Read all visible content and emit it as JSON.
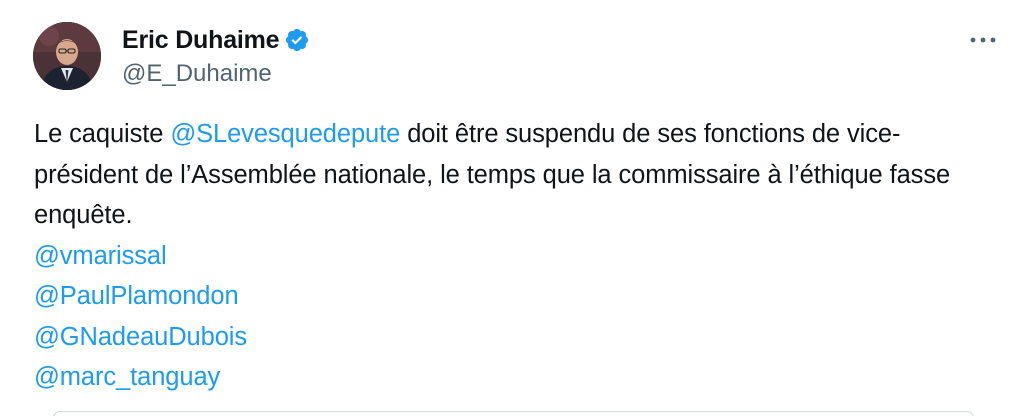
{
  "user": {
    "display_name": "Eric Duhaime",
    "handle": "@E_Duhaime",
    "verified_icon": "verified-badge-icon"
  },
  "tweet": {
    "text_before_mention": "Le caquiste ",
    "inline_mention": "@SLevesquedepute",
    "text_after_mention": " doit être suspendu de ses fonctions de vice-président de l’Assemblée nationale, le temps que la commissaire à l’éthique fasse enquête.",
    "mentions": [
      "@vmarissal",
      "@PaulPlamondon",
      "@GNadeauDubois",
      "@marc_tanguay"
    ]
  },
  "actions": {
    "more_icon": "more-options-icon"
  },
  "colors": {
    "text": "#0f1419",
    "secondary": "#536471",
    "link": "#1d9bf0",
    "verified": "#1d9bf0",
    "border": "#cfd9de"
  }
}
